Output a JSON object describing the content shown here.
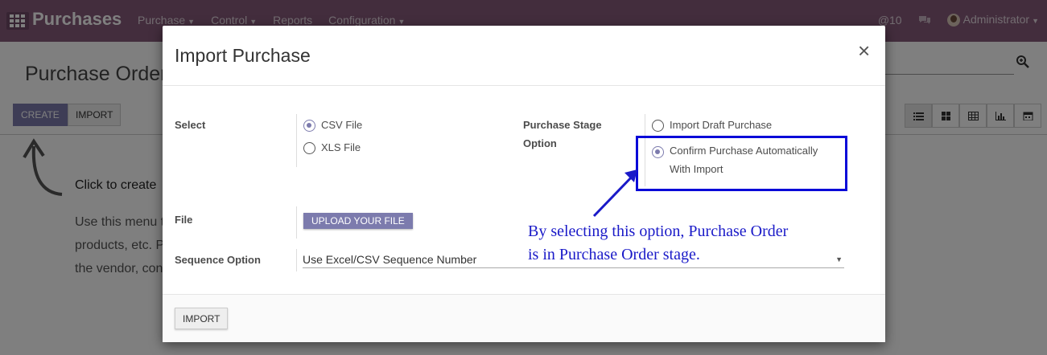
{
  "navbar": {
    "app_name": "Purchases",
    "menu": [
      "Purchase",
      "Control",
      "Reports",
      "Configuration"
    ],
    "menu_dropdown": [
      true,
      true,
      false,
      true
    ],
    "notifications": "@10",
    "user": "Administrator",
    "background_color": "#875a7b"
  },
  "control_panel": {
    "breadcrumb": "Purchase Order",
    "create_label": "CREATE",
    "import_label": "IMPORT",
    "views": [
      "list-icon",
      "kanban-icon",
      "pivot-icon",
      "graph-icon",
      "calendar-icon"
    ]
  },
  "helper": {
    "main": "Click to create",
    "line1": "Use this menu t",
    "line2": "products, etc. P",
    "line3": "the vendor, con"
  },
  "modal": {
    "title": "Import Purchase",
    "close_symbol": "×",
    "select_label": "Select",
    "file_types": [
      {
        "label": "CSV File",
        "checked": true
      },
      {
        "label": "XLS File",
        "checked": false
      }
    ],
    "stage_label_1": "Purchase Stage",
    "stage_label_2": "Option",
    "stage_options": [
      {
        "label": "Import Draft Purchase",
        "checked": false
      },
      {
        "label_1": "Confirm Purchase Automatically",
        "label_2": "With Import",
        "checked": true
      }
    ],
    "file_label": "File",
    "upload_label": "UPLOAD YOUR FILE",
    "sequence_label": "Sequence Option",
    "sequence_value": "Use Excel/CSV Sequence Number",
    "footer_import_label": "IMPORT"
  },
  "annotation": {
    "line1": "By selecting this option, Purchase Order",
    "line2": "is in Purchase Order stage.",
    "color": "#1a1ac8"
  }
}
